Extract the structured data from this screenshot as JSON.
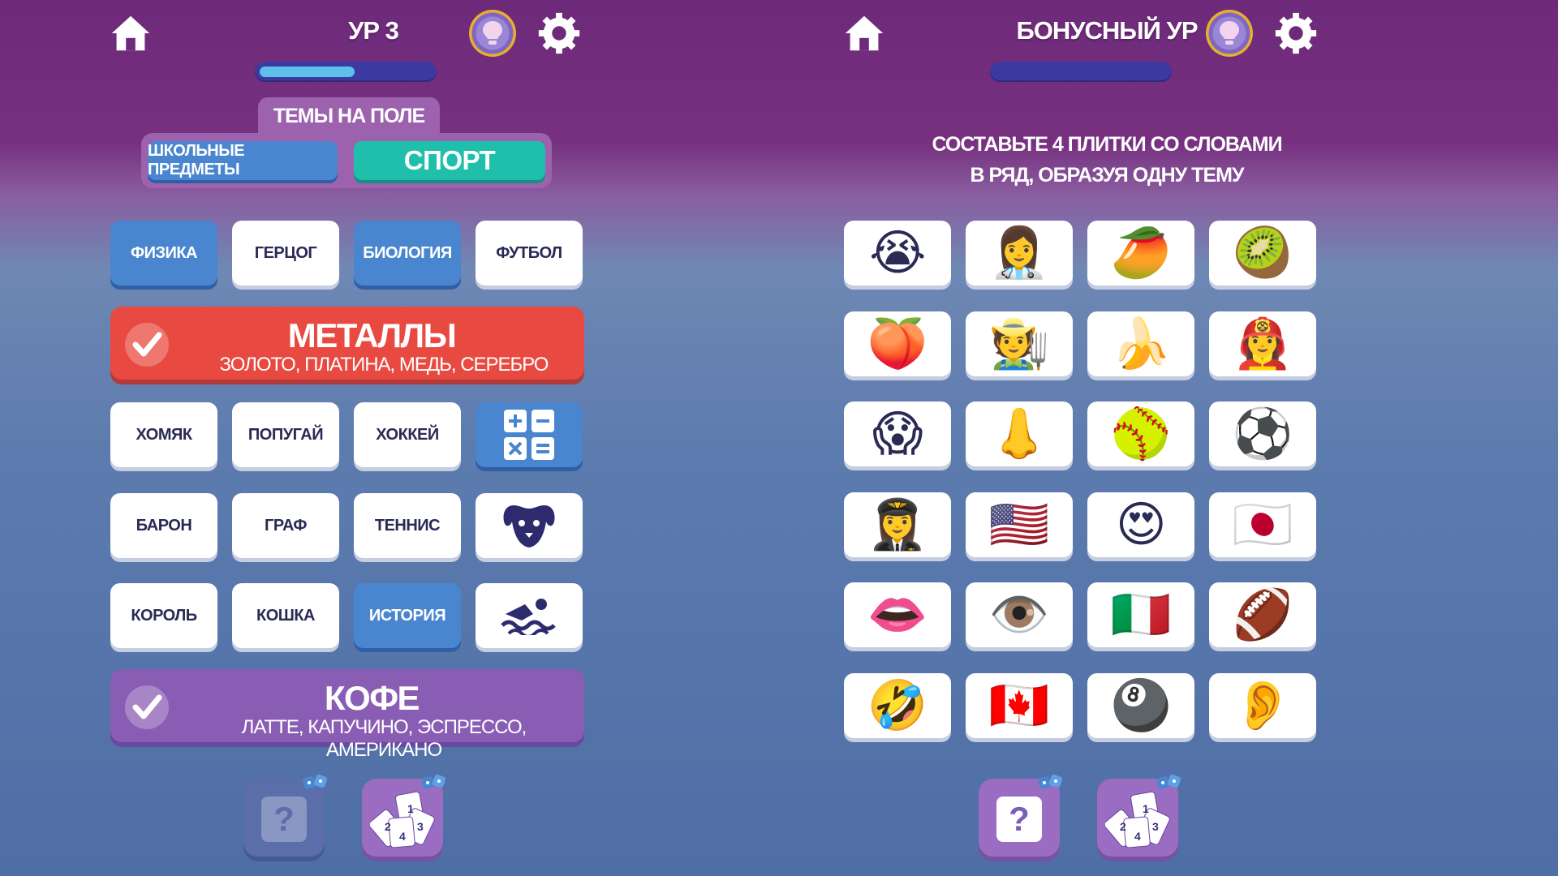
{
  "colors": {
    "accent_blue": "#4a86d0",
    "sport_green": "#1fbfac",
    "banner_red": "#e84a41",
    "banner_purple": "#8a5db5",
    "progress_fill": "#5cc0ea"
  },
  "left": {
    "level_title": "УР 3",
    "progress": 0.55,
    "themes_label": "ТЕМЫ НА ПОЛЕ",
    "themes": [
      "ШКОЛЬНЫЕ ПРЕДМЕТЫ",
      "СПОРТ"
    ],
    "row1": [
      "ФИЗИКА",
      "ГЕРЦОГ",
      "БИОЛОГИЯ",
      "ФУТБОЛ"
    ],
    "banner1": {
      "title": "МЕТАЛЛЫ",
      "words": "ЗОЛОТО, ПЛАТИНА, МЕДЬ, СЕРЕБРО"
    },
    "row3": [
      "ХОМЯК",
      "ПОПУГАЙ",
      "ХОККЕЙ",
      "calculator-icon"
    ],
    "row4": [
      "БАРОН",
      "ГРАФ",
      "ТЕННИС",
      "dog-icon"
    ],
    "row5": [
      "КОРОЛЬ",
      "КОШКА",
      "ИСТОРИЯ",
      "swimmer-icon"
    ],
    "banner2": {
      "title": "КОФЕ",
      "words": "ЛАТТЕ, КАПУЧИНО, ЭСПРЕССО, АМЕРИКАНО"
    },
    "power_ups": [
      "hint-question-icon",
      "shuffle-cards-icon"
    ]
  },
  "right": {
    "level_title": "БОНУСНЫЙ УР",
    "progress": 0.0,
    "instruction_line1": "СОСТАВЬТЕ 4 ПЛИТКИ СО СЛОВАМИ",
    "instruction_line2": "В РЯД, ОБРАЗУЯ ОДНУ ТЕМУ",
    "emoji_rows": [
      [
        "😭",
        "👩‍⚕️",
        "🥭",
        "🥝"
      ],
      [
        "🍑",
        "🧑‍🌾",
        "🍌",
        "👩‍🚒"
      ],
      [
        "😱",
        "👃",
        "🥎",
        "⚽"
      ],
      [
        "👩‍✈️",
        "🇺🇸",
        "😍",
        "🇯🇵"
      ],
      [
        "👄",
        "👁️",
        "🇮🇹",
        "🏈"
      ],
      [
        "🤣",
        "🇨🇦",
        "🎱",
        "👂"
      ]
    ],
    "power_ups": [
      "hint-question-icon",
      "shuffle-cards-icon"
    ]
  },
  "card_numbers": [
    "1",
    "2",
    "3",
    "4"
  ],
  "question_mark": "?"
}
